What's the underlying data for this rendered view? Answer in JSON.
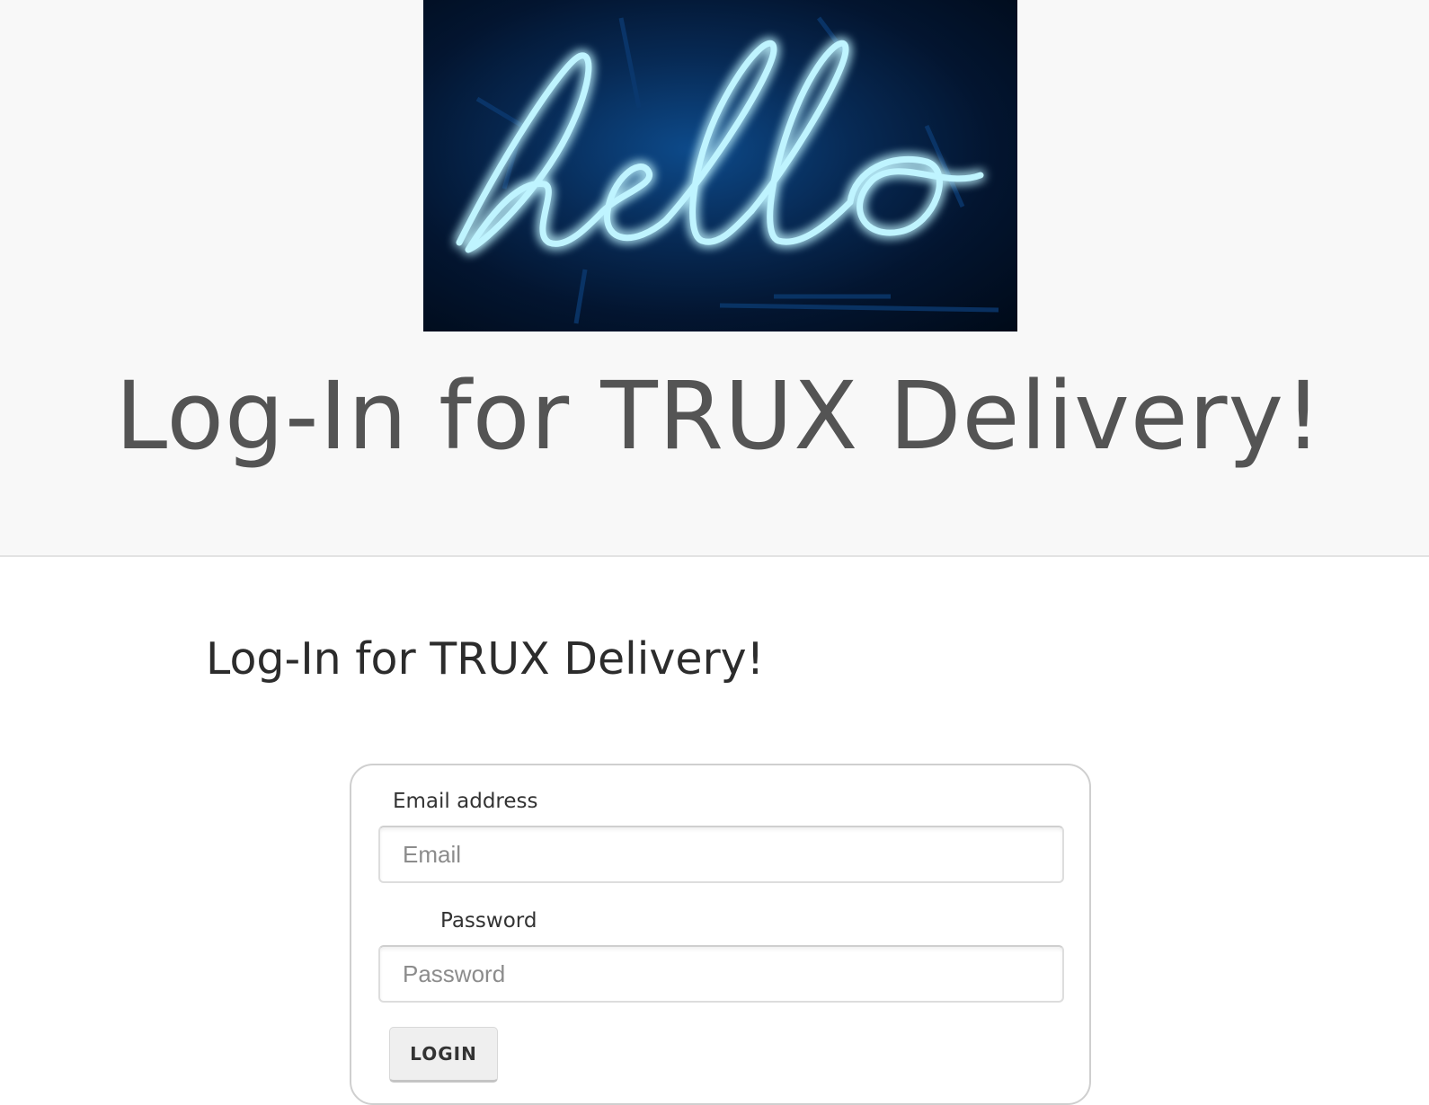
{
  "hero": {
    "image_text": "hello",
    "title": "Log-In for TRUX Delivery!",
    "image_colors": {
      "background": "#031530",
      "neon": "#7fe6ff",
      "glow": "#1a9cff"
    }
  },
  "main": {
    "heading": "Log-In for TRUX Delivery!"
  },
  "form": {
    "email_label": "Email address",
    "email_placeholder": "Email",
    "email_value": "",
    "password_label": "Password",
    "password_placeholder": "Password",
    "password_value": "",
    "login_label": "LOGIN"
  }
}
